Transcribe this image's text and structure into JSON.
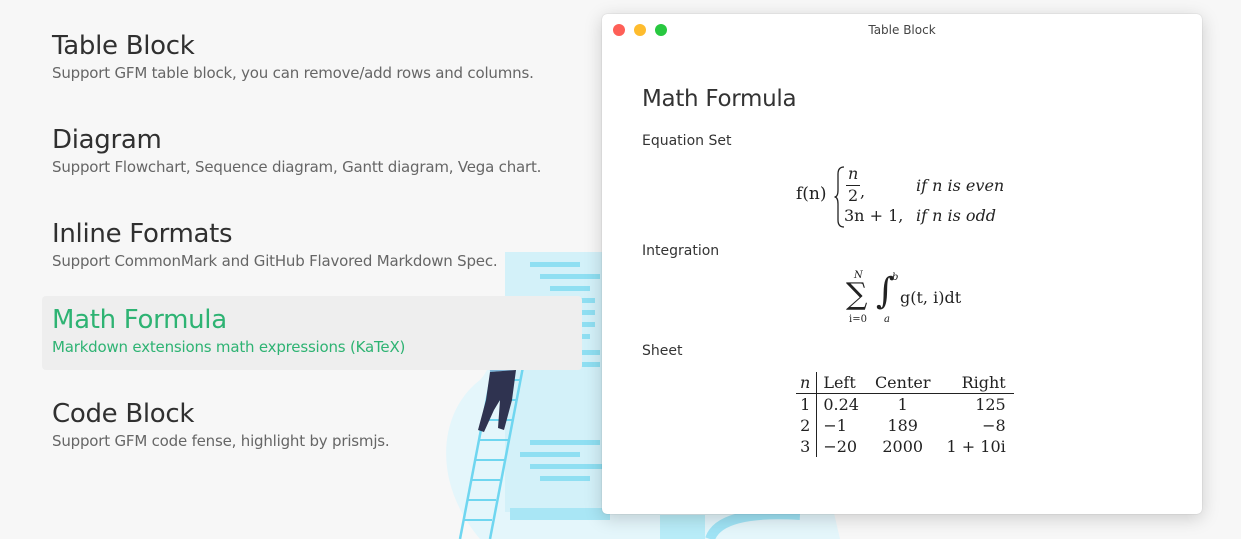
{
  "features": [
    {
      "title": "Table Block",
      "desc": "Support GFM table block, you can remove/add rows and columns."
    },
    {
      "title": "Diagram",
      "desc": "Support Flowchart, Sequence diagram, Gantt diagram, Vega chart."
    },
    {
      "title": "Inline Formats",
      "desc": "Support CommonMark and GitHub Flavored Markdown Spec."
    },
    {
      "title": "Math Formula",
      "desc": "Markdown extensions math expressions (KaTeX)"
    },
    {
      "title": "Code Block",
      "desc": "Support GFM code fense, highlight by prismjs."
    }
  ],
  "active_feature": "Math Formula",
  "colors": {
    "accent": "#2eb373",
    "illustration": "#5fd3ef"
  },
  "window": {
    "title": "Table Block",
    "heading": "Math Formula",
    "equation_set": {
      "label": "Equation Set",
      "lhs": "f(n)",
      "case1_num": "n",
      "case1_den": "2",
      "case1_cond": "if n is even",
      "case2": "3n + 1,",
      "case2_cond": "if n is odd"
    },
    "integration": {
      "label": "Integration",
      "sum_upper": "N",
      "sum_lower": "i=0",
      "int_upper": "b",
      "int_lower": "a",
      "integrand": "g(t, i)dt"
    },
    "sheet": {
      "label": "Sheet",
      "headers": [
        "n",
        "Left",
        "Center",
        "Right"
      ],
      "rows": [
        [
          "1",
          "0.24",
          "1",
          "125"
        ],
        [
          "2",
          "−1",
          "189",
          "−8"
        ],
        [
          "3",
          "−20",
          "2000",
          "1 + 10i"
        ]
      ]
    }
  }
}
